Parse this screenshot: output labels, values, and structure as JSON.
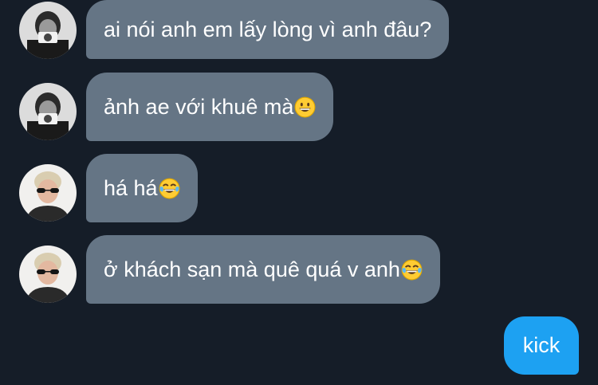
{
  "conversation": {
    "messages": [
      {
        "sender": "other",
        "text": "ai nói anh em lấy lòng vì anh đâu?",
        "emoji": ""
      },
      {
        "sender": "other",
        "text": "ảnh ae với khuê mà",
        "emoji": "grinning-face-emoji"
      },
      {
        "sender": "other",
        "text": "há há",
        "emoji": "tears-of-joy-emoji"
      },
      {
        "sender": "other",
        "text": "ở khách sạn mà quê quá v anh",
        "emoji": "tears-of-joy-emoji"
      },
      {
        "sender": "me",
        "text": "kick",
        "emoji": ""
      }
    ]
  },
  "colors": {
    "background": "#151d28",
    "incoming_bubble": "#657585",
    "outgoing_bubble": "#1da1f2",
    "text": "#ffffff"
  }
}
